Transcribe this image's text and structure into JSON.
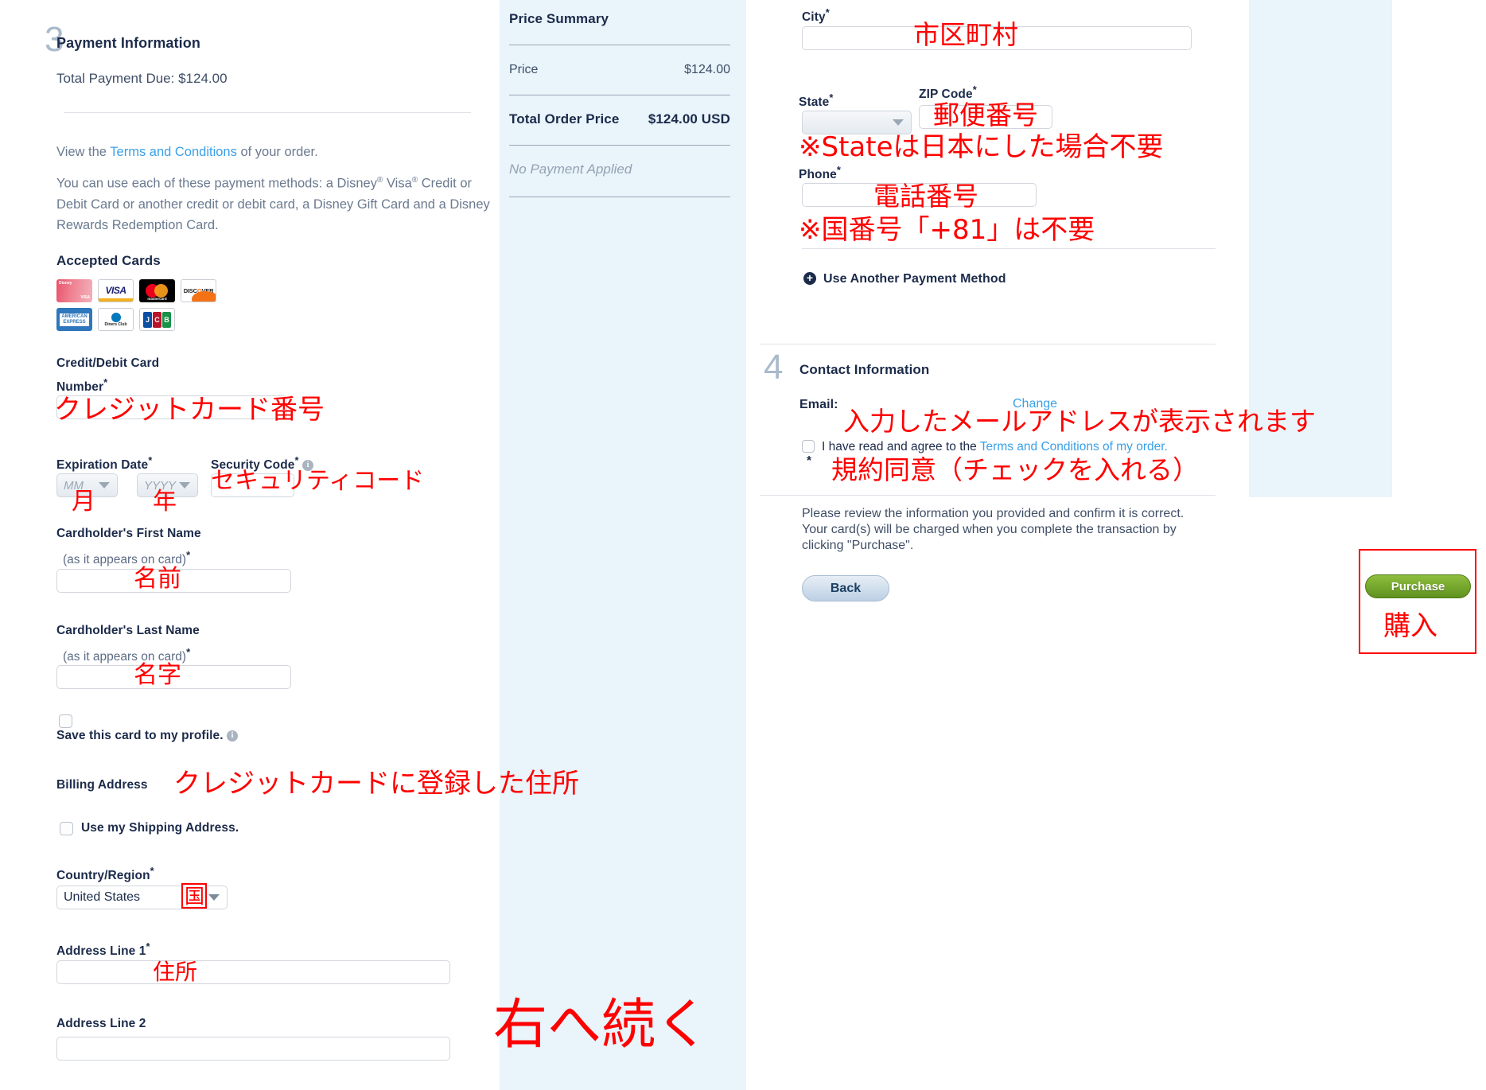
{
  "step3": {
    "number": "3",
    "title": "Payment Information",
    "total_due": "Total Payment Due: $124.00",
    "view_terms_pre": "View the ",
    "view_terms_link": "Terms and Conditions",
    "view_terms_post": " of your order.",
    "methods_text_1": "You can use each of these payment methods: a Disney",
    "methods_sup_1": "®",
    "methods_text_2": " Visa",
    "methods_sup_2": "®",
    "methods_text_3": "Credit or Debit Card or another credit or debit card, a Disney Gift Card and a Disney Rewards Redemption Card.",
    "accepted_cards_label": "Accepted Cards",
    "cards": [
      {
        "name": "disney-visa-card-icon",
        "label": "Disney Visa"
      },
      {
        "name": "visa-card-icon",
        "label": "VISA"
      },
      {
        "name": "mastercard-card-icon",
        "label": "mastercard"
      },
      {
        "name": "discover-card-icon",
        "label": "DISCOVER"
      },
      {
        "name": "amex-card-icon",
        "label": "AMERICAN EXPRESS"
      },
      {
        "name": "diners-club-card-icon",
        "label": "Diners Club INTERNATIONAL"
      },
      {
        "name": "jcb-card-icon",
        "label": "JCB"
      }
    ],
    "cc_label_l1": "Credit/Debit Card",
    "cc_label_l2": "Number",
    "expiration_label": "Expiration Date",
    "security_label": "Security Code",
    "month_placeholder": "MM",
    "year_placeholder": "YYYY",
    "first_name_l1": "Cardholder's First Name",
    "first_name_l2": "(as it appears on card)",
    "last_name_l1": "Cardholder's Last Name",
    "last_name_l2": "(as it appears on card)",
    "save_card_label": "Save this card to my profile.",
    "billing_address_label": "Billing Address",
    "use_shipping_label": "Use my Shipping Address.",
    "country_label": "Country/Region",
    "country_value": "United States",
    "address1_label": "Address Line 1",
    "address2_label": "Address Line 2"
  },
  "price_summary": {
    "title": "Price Summary",
    "rows": [
      {
        "label": "Price",
        "value": "$124.00"
      }
    ],
    "total_label": "Total Order Price",
    "total_value": "$124.00 USD",
    "no_payment": "No Payment Applied"
  },
  "billing_right": {
    "city_label": "City",
    "state_label": "State",
    "state_value": "",
    "zip_label": "ZIP Code",
    "phone_label": "Phone",
    "another_method_label": "Use Another Payment Method"
  },
  "step4": {
    "number": "4",
    "title": "Contact Information",
    "email_label": "Email:",
    "change_label": "Change",
    "agree_pre": "I have read and agree to the ",
    "agree_link": "Terms and Conditions of my order.",
    "agree_star": "*",
    "review_text": "Please review the information you provided and confirm it is correct. Your card(s) will be charged when you complete the transaction by clicking \"Purchase\".",
    "back_label": "Back",
    "purchase_label": "Purchase"
  },
  "annotations": {
    "cc_number": "クレジットカード番号",
    "security_code": "セキュリティコード",
    "month": "月",
    "year": "年",
    "first_name": "名前",
    "last_name": "名字",
    "billing_address": "クレジットカードに登録した住所",
    "country": "国",
    "address1": "住所",
    "continue_right": "右へ続く",
    "city": "市区町村",
    "zip": "郵便番号",
    "state_note": "※Stateは日本にした場合不要",
    "phone": "電話番号",
    "phone_note": "※国番号「+81」は不要",
    "email_note": "入力したメールアドレスが表示されます",
    "agree_note": "規約同意（チェックを入れる）",
    "purchase": "購入"
  },
  "colors": {
    "annotation_red": "#ff0000",
    "link_blue": "#3aa0e8",
    "heading_navy": "#1c2b4a",
    "panel_blue": "#e9f4fb",
    "purchase_green": "#6fa32a"
  }
}
